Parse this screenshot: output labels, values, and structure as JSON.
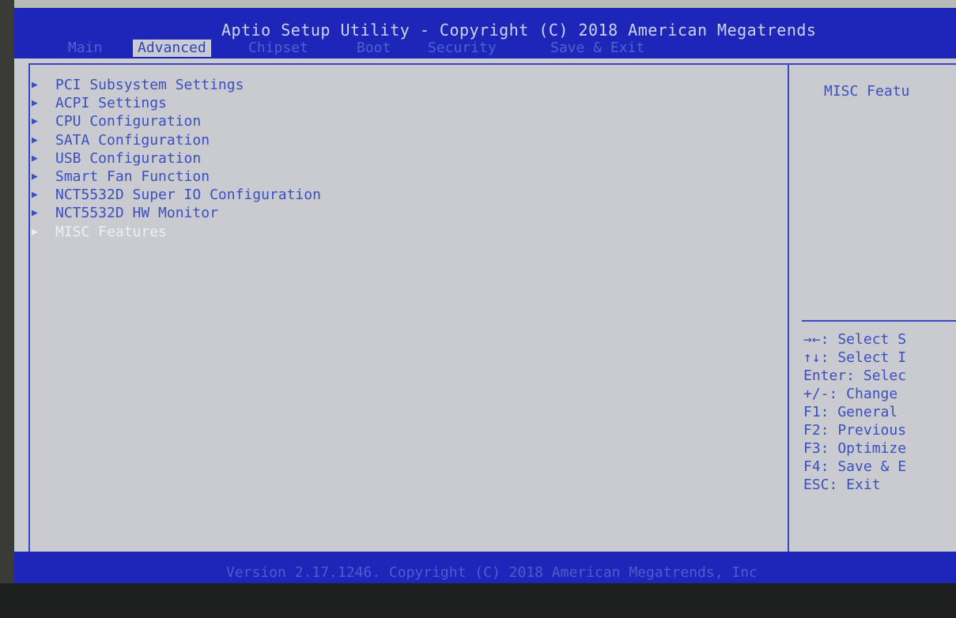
{
  "header": {
    "title": "Aptio Setup Utility - Copyright (C) 2018 American Megatrends",
    "tabs": [
      {
        "label": "Main"
      },
      {
        "label": "Advanced"
      },
      {
        "label": "Chipset"
      },
      {
        "label": "Boot"
      },
      {
        "label": "Security"
      },
      {
        "label": "Save & Exit"
      }
    ],
    "active_tab": "Advanced"
  },
  "menu": {
    "items": [
      {
        "label": "PCI Subsystem Settings"
      },
      {
        "label": "ACPI Settings"
      },
      {
        "label": "CPU Configuration"
      },
      {
        "label": "SATA Configuration"
      },
      {
        "label": "USB Configuration"
      },
      {
        "label": "Smart Fan Function"
      },
      {
        "label": "NCT5532D Super IO Configuration"
      },
      {
        "label": "NCT5532D HW Monitor"
      },
      {
        "label": "MISC Features"
      }
    ],
    "selected_item": "MISC Features",
    "arrow_glyph": "▶"
  },
  "help": {
    "description": "MISC Featu",
    "keys": [
      "→←: Select S",
      "↑↓: Select I",
      "Enter: Selec",
      "+/-: Change",
      "F1: General",
      "F2: Previous",
      "F3: Optimize",
      "F4: Save & E",
      "ESC: Exit"
    ]
  },
  "footer": {
    "text": "Version 2.17.1246. Copyright (C) 2018 American Megatrends, Inc"
  },
  "colors": {
    "header_bg": "#1d26b8",
    "body_bg": "#c9cbd0",
    "text_blue": "#3c4fbf",
    "selected_text": "#eef0f4",
    "border": "#3a49c2"
  }
}
